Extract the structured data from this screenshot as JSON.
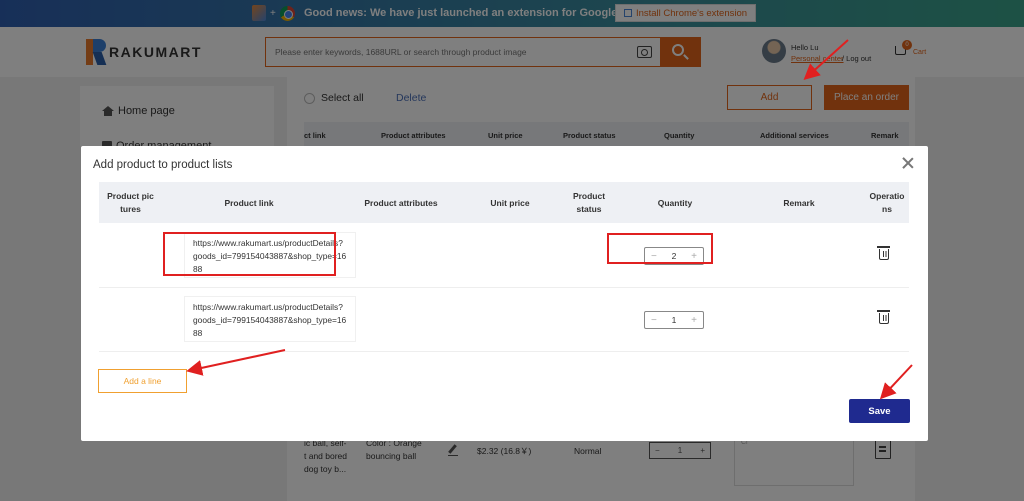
{
  "banner": {
    "news": "Good news: We have just launched an extension for Google Chrome",
    "extension_button": "Install Chrome's extension",
    "plus": "+"
  },
  "header": {
    "brand": "RAKUMART",
    "search_placeholder": "Please enter keywords, 1688URL or search through product image",
    "greeting": "Hello Lu",
    "personal_center": "Personal center",
    "logout": "/ Log out",
    "cart_label": "Cart",
    "cart_count": "0"
  },
  "sidebar": {
    "items": [
      {
        "label": "Home page",
        "icon": "home-icon"
      },
      {
        "label": "Order management",
        "icon": "orders-icon"
      }
    ]
  },
  "toolbar": {
    "select_all": "Select all",
    "delete": "Delete",
    "add": "Add",
    "place_order": "Place an order"
  },
  "background_table": {
    "headers": [
      "ct link",
      "Product attributes",
      "Unit price",
      "Product status",
      "Quantity",
      "Additional services",
      "Remark"
    ],
    "row": {
      "link_text": "ic ball, self-\nt and bored\ndog toy b...",
      "attributes": "Color : Orange\nbouncing ball",
      "unit_price": "$2.32 (16.8￥)",
      "status": "Normal",
      "quantity": "1",
      "remark_placeholder": "Cl"
    }
  },
  "modal": {
    "title": "Add product to product lists",
    "headers": {
      "pictures": "Product pic\ntures",
      "link": "Product link",
      "attributes": "Product attributes",
      "unit_price": "Unit price",
      "status": "Product\nstatus",
      "quantity": "Quantity",
      "remark": "Remark",
      "operations": "Operatio\nns"
    },
    "rows": [
      {
        "link": "https://www.rakumart.us/productDetails?goods_id=799154043887&shop_type=1688",
        "quantity": "2"
      },
      {
        "link": "https://www.rakumart.us/productDetails?goods_id=799154043887&shop_type=1688",
        "quantity": "1"
      }
    ],
    "stepper": {
      "minus": "−",
      "plus": "+"
    },
    "add_line": "Add a line",
    "save": "Save"
  },
  "colors": {
    "accent": "#e2651a",
    "save": "#1f2a8f",
    "annotation": "#e02020"
  }
}
